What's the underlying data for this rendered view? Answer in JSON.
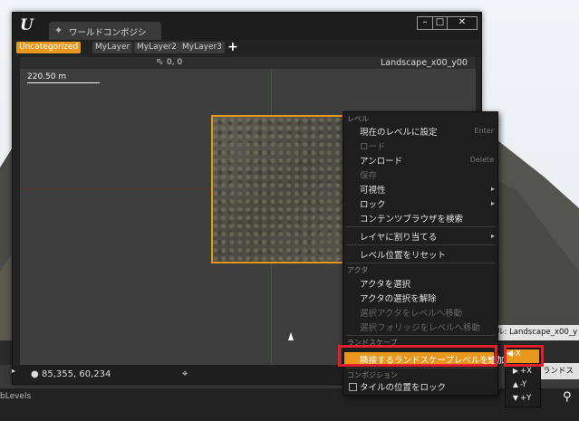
{
  "window": {
    "tab_title": "ワールドコンポジシ",
    "logo": "U",
    "min_label": "–",
    "max_label": "□",
    "close_label": "✕"
  },
  "layers": {
    "items": [
      "Uncategorized",
      "MyLayer",
      "MyLayer2",
      "MyLayer3"
    ],
    "add_label": "+"
  },
  "viewport": {
    "coords": "0, 0",
    "level_name": "Landscape_x00_y00",
    "scale": "220.50 m"
  },
  "status": {
    "mouse_coords": "85,355, 60,234"
  },
  "right_panel": {
    "level_label": "ル: Landscape_x00_y",
    "landscape_button": "ランドス",
    "levels_tab": "bLevels"
  },
  "menu": {
    "section_level": "レベル",
    "set_current": "現在のレベルに設定",
    "set_current_shortcut": "Enter",
    "load": "ロード",
    "unload": "アンロード",
    "unload_shortcut": "Delete",
    "save": "保存",
    "visibility": "可視性",
    "lock": "ロック",
    "find_in_browser": "コンテンツブラウザを検索",
    "assign_layer": "レイヤに割り当てる",
    "reset_position": "レベル位置をリセット",
    "section_actor": "アクタ",
    "select_actors": "アクタを選択",
    "deselect_actors": "アクタの選択を解除",
    "move_actors": "選択アクタをレベルへ移動",
    "move_foliage": "選択フォリッジをレベルへ移動",
    "section_landscape": "ランドスケープ",
    "add_adjacent": "隣接するランドスケープレベルを追加",
    "section_composition": "コンポジション",
    "lock_tiles": "タイルの位置をロック"
  },
  "submenu": {
    "neg_x": "-X",
    "pos_x": "+X",
    "neg_y": "-Y",
    "pos_y": "+Y"
  },
  "colors": {
    "accent": "#e8961c",
    "highlight_outline": "#e0202a"
  }
}
